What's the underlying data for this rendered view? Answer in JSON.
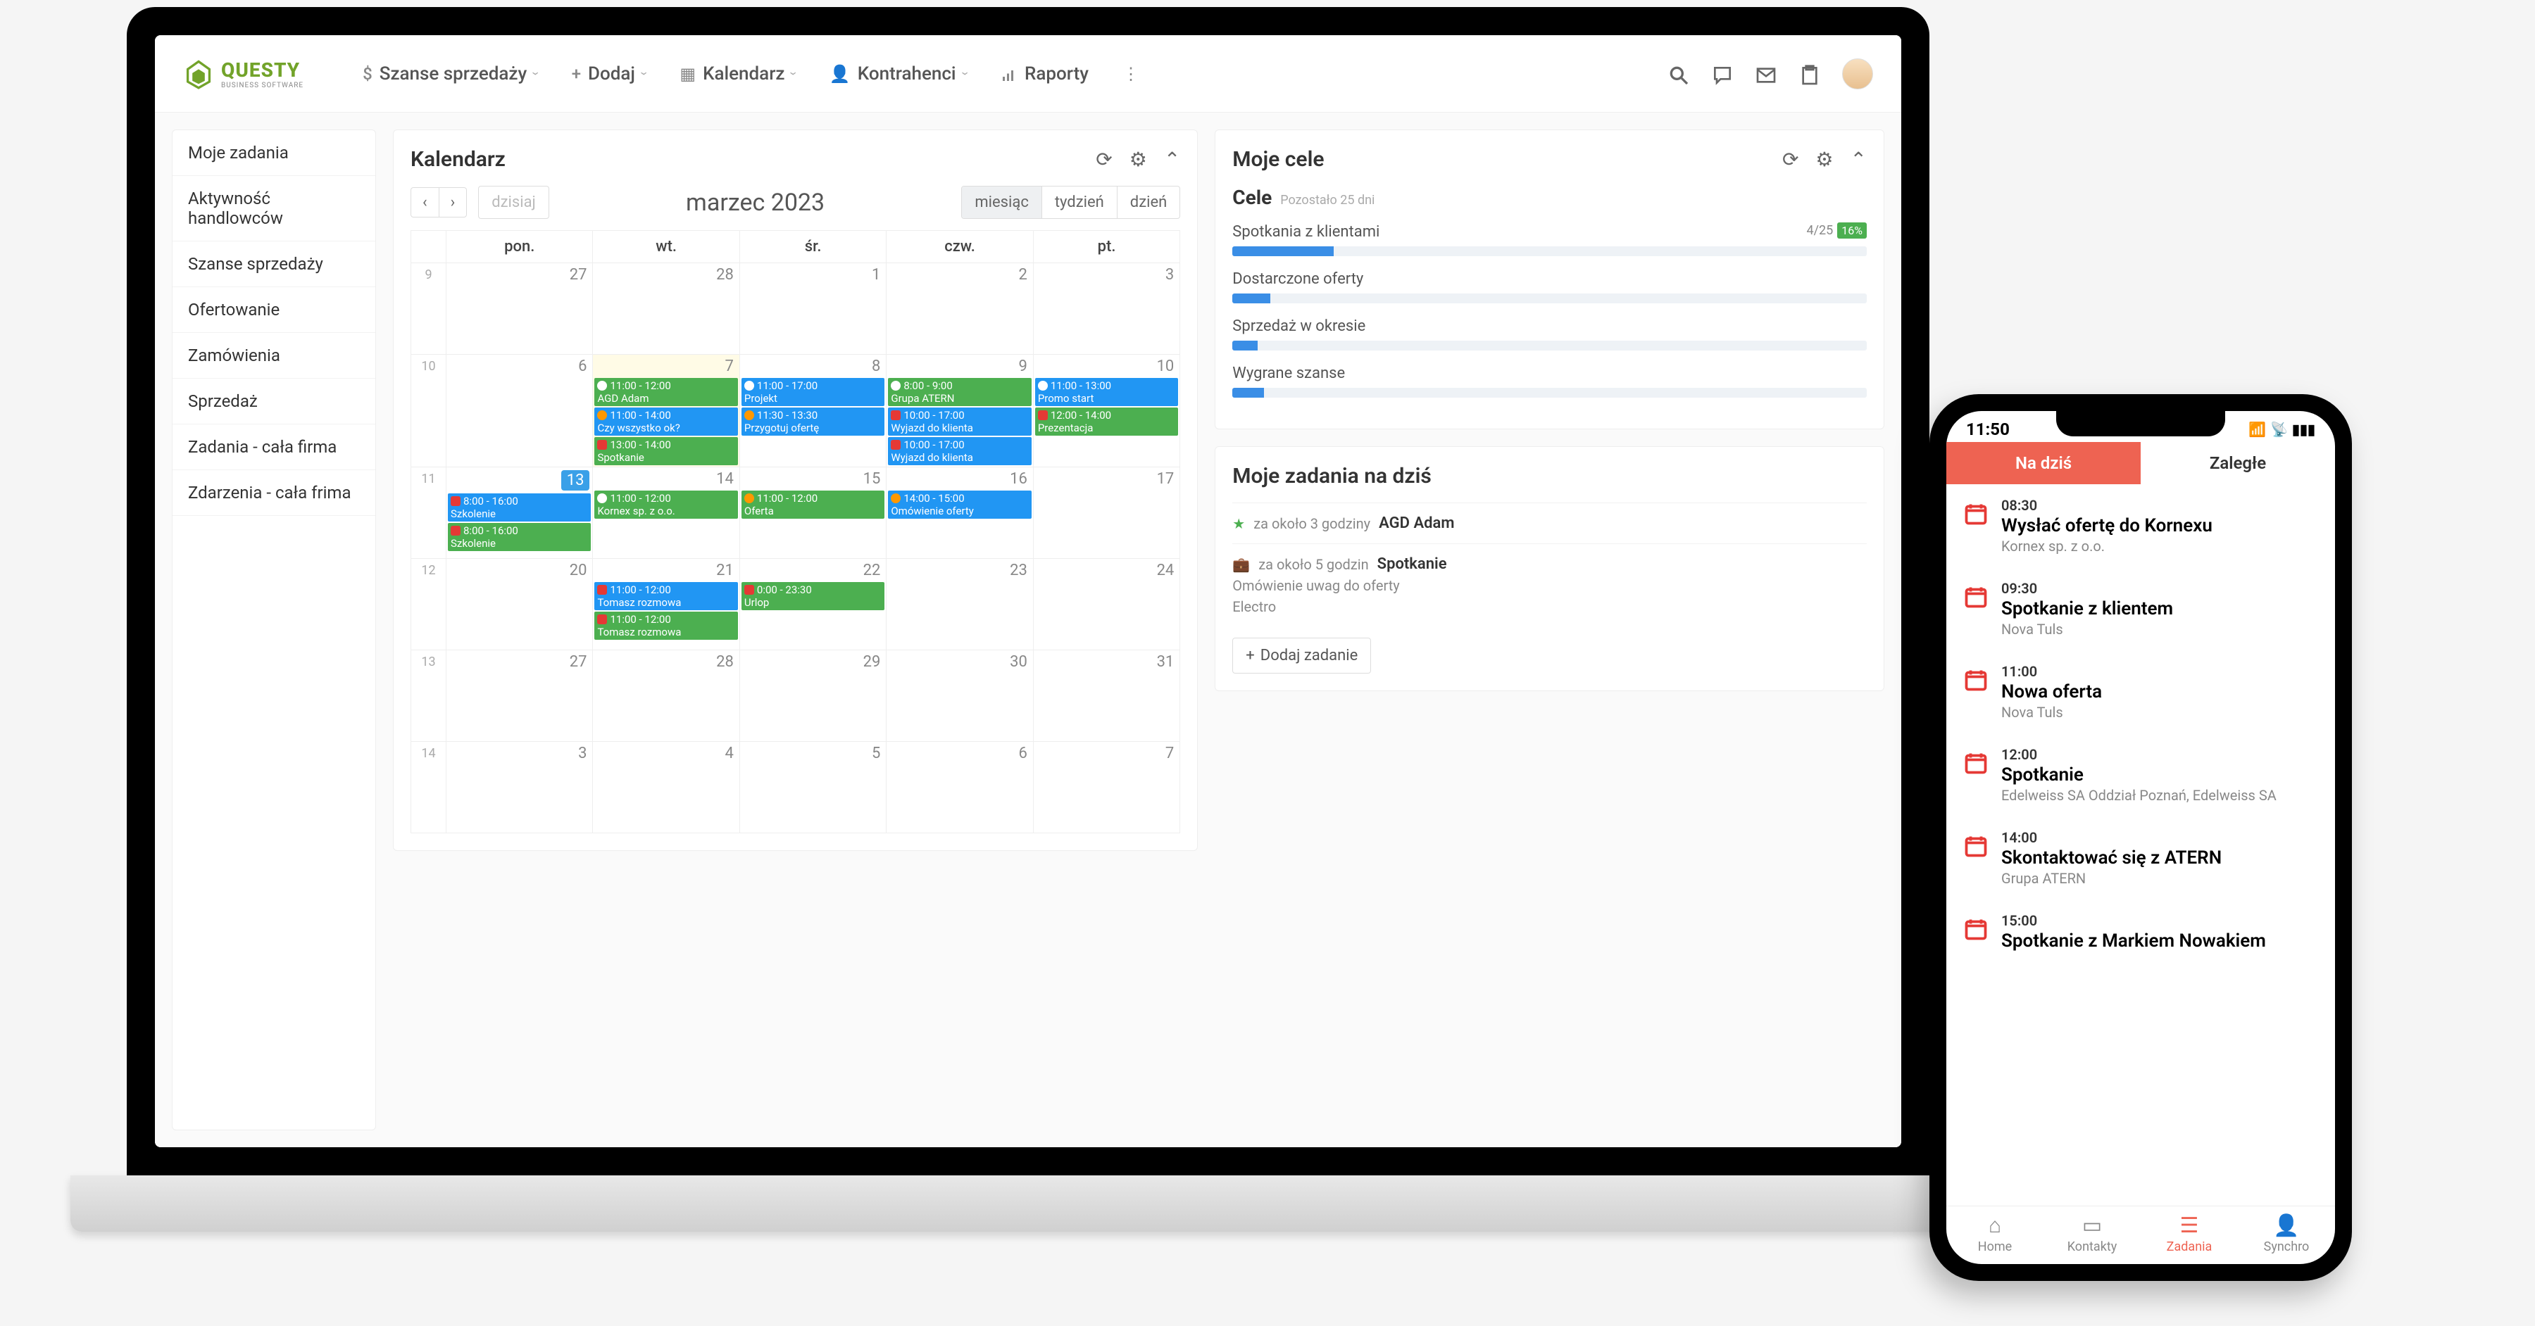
{
  "logo": {
    "name": "QUESTY",
    "tagline": "BUSINESS SOFTWARE"
  },
  "nav": {
    "items": [
      {
        "label": "Szanse sprzedaży",
        "icon": "$"
      },
      {
        "label": "Dodaj",
        "icon": "+"
      },
      {
        "label": "Kalendarz",
        "icon": "📅"
      },
      {
        "label": "Kontrahenci",
        "icon": "👤"
      },
      {
        "label": "Raporty",
        "icon": "📊"
      }
    ]
  },
  "sidebar": {
    "items": [
      {
        "label": "Moje zadania"
      },
      {
        "label": "Aktywność handlowców"
      },
      {
        "label": "Szanse sprzedaży"
      },
      {
        "label": "Ofertowanie"
      },
      {
        "label": "Zamówienia"
      },
      {
        "label": "Sprzedaż"
      },
      {
        "label": "Zadania - cała firma"
      },
      {
        "label": "Zdarzenia - cała frima"
      }
    ]
  },
  "calendar": {
    "title": "Kalendarz",
    "today_btn": "dzisiaj",
    "month_label": "marzec 2023",
    "views": {
      "month": "miesiąc",
      "week": "tydzień",
      "day": "dzień"
    },
    "dow": {
      "mon": "pon.",
      "tue": "wt.",
      "wed": "śr.",
      "thu": "czw.",
      "fri": "pt."
    },
    "weeks": [
      "9",
      "10",
      "11",
      "12",
      "13",
      "14"
    ],
    "grid": {
      "r0": {
        "d0": "27",
        "d1": "28",
        "d2": "1",
        "d3": "2",
        "d4": "3"
      },
      "r1": {
        "d0": "6",
        "d1": "7",
        "d2": "8",
        "d3": "9",
        "d4": "10"
      },
      "r2": {
        "d0": "13",
        "d1": "14",
        "d2": "15",
        "d3": "16",
        "d4": "17"
      },
      "r3": {
        "d0": "20",
        "d1": "21",
        "d2": "22",
        "d3": "23",
        "d4": "24"
      },
      "r4": {
        "d0": "27",
        "d1": "28",
        "d2": "29",
        "d3": "30",
        "d4": "31"
      },
      "r5": {
        "d0": "3",
        "d1": "4",
        "d2": "5",
        "d3": "6",
        "d4": "7"
      }
    },
    "events": {
      "r1d1_0": {
        "time": "11:00 - 12:00",
        "label": "AGD Adam"
      },
      "r1d1_1": {
        "time": "11:00 - 14:00",
        "label": "Czy wszystko ok?"
      },
      "r1d1_2": {
        "time": "13:00 - 14:00",
        "label": "Spotkanie"
      },
      "r1d2_0": {
        "time": "11:00 - 17:00",
        "label": "Projekt"
      },
      "r1d2_1": {
        "time": "11:30 - 13:30",
        "label": "Przygotuj ofertę"
      },
      "r1d3_0": {
        "time": "8:00 - 9:00",
        "label": "Grupa ATERN"
      },
      "r1d3_1": {
        "time": "10:00 - 17:00",
        "label": "Wyjazd do klienta"
      },
      "r1d3_2": {
        "time": "10:00 - 17:00",
        "label": "Wyjazd do klienta"
      },
      "r1d4_0": {
        "time": "11:00 - 13:00",
        "label": "Promo start"
      },
      "r1d4_1": {
        "time": "12:00 - 14:00",
        "label": "Prezentacja"
      },
      "r2d0_0": {
        "time": "8:00 - 16:00",
        "label": "Szkolenie"
      },
      "r2d0_1": {
        "time": "8:00 - 16:00",
        "label": "Szkolenie"
      },
      "r2d1_0": {
        "time": "11:00 - 12:00",
        "label": "Kornex sp. z o.o."
      },
      "r2d2_0": {
        "time": "11:00 - 12:00",
        "label": "Oferta"
      },
      "r2d3_0": {
        "time": "14:00 - 15:00",
        "label": "Omówienie oferty"
      },
      "r3d1_0": {
        "time": "11:00 - 12:00",
        "label": "Tomasz rozmowa"
      },
      "r3d1_1": {
        "time": "11:00 - 12:00",
        "label": "Tomasz rozmowa"
      },
      "r3d2_0": {
        "time": "0:00 - 23:30",
        "label": "Urlop"
      }
    }
  },
  "goals": {
    "title": "Moje cele",
    "heading": "Cele",
    "subtitle": "Pozostało 25 dni",
    "rows": [
      {
        "label": "Spotkania z klientami",
        "value": "4/25",
        "badge": "16%",
        "pct": 16
      },
      {
        "label": "Dostarczone oferty",
        "value": "",
        "badge": "",
        "pct": 6
      },
      {
        "label": "Sprzedaż w okresie",
        "value": "",
        "badge": "",
        "pct": 4
      },
      {
        "label": "Wygrane szanse",
        "value": "",
        "badge": "",
        "pct": 5
      }
    ]
  },
  "today_tasks": {
    "title": "Moje zadania na dziś",
    "rows": [
      {
        "icon": "star",
        "when": "za około 3 godziny",
        "title": "AGD Adam",
        "sub": "",
        "sub2": ""
      },
      {
        "icon": "bag",
        "when": "za około 5 godzin",
        "title": "Spotkanie",
        "sub": "Omówienie uwag do oferty",
        "sub2": "Electro"
      }
    ],
    "add_btn": "Dodaj zadanie"
  },
  "phone": {
    "time": "11:50",
    "tabs": {
      "today": "Na dziś",
      "overdue": "Zaległe"
    },
    "tasks": [
      {
        "time": "08:30",
        "title": "Wysłać ofertę do Kornexu",
        "sub": "Kornex sp. z o.o."
      },
      {
        "time": "09:30",
        "title": "Spotkanie z klientem",
        "sub": "Nova Tuls"
      },
      {
        "time": "11:00",
        "title": "Nowa oferta",
        "sub": "Nova Tuls"
      },
      {
        "time": "12:00",
        "title": "Spotkanie",
        "sub": "Edelweiss SA Oddział Poznań, Edelweiss SA"
      },
      {
        "time": "14:00",
        "title": "Skontaktować się z ATERN",
        "sub": "Grupa ATERN"
      },
      {
        "time": "15:00",
        "title": "Spotkanie z Markiem Nowakiem",
        "sub": ""
      }
    ],
    "nav": {
      "home": "Home",
      "contacts": "Kontakty",
      "tasks": "Zadania",
      "sync": "Synchro"
    }
  }
}
